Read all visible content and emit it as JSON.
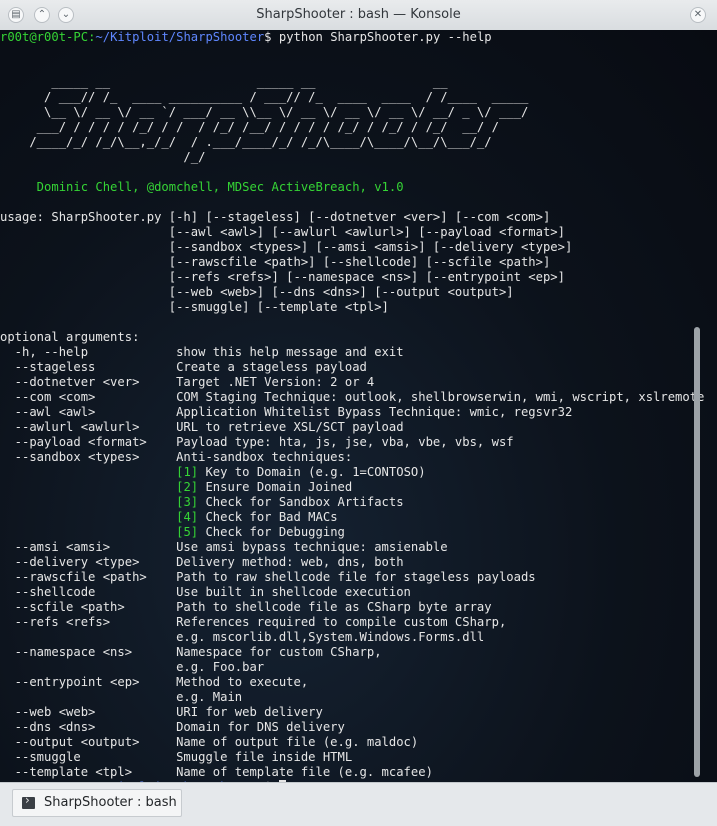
{
  "window": {
    "title": "SharpShooter : bash — Konsole"
  },
  "titlebar": {
    "menu_icon": "konsole-menu-icon",
    "keep_above_icon": "chevron-up-icon",
    "minimize_icon": "chevron-down-icon",
    "close_icon": "close-icon"
  },
  "prompt": {
    "user": "r00t@r00t-PC",
    "path": "~/Kitploit/SharpShooter"
  },
  "command": "python SharpShooter.py --help",
  "banner": [
    "       _____ __                    _____ __                __",
    "      / ___// /_  ____ __________ / ___// /_  ____  ____  / /____  _____",
    "      \\__ \\/ __ \\/ __ `/ ___/ __ \\\\__ \\/ __ \\/ __ \\/ __ \\/ __/ _ \\/ ___/",
    "     ___/ / / / / /_/ / /  / /_/ /__/ / / / / /_/ / /_/ / /_/  __/ /",
    "    /____/_/ /_/\\__,_/_/  / .___/____/_/ /_/\\____/\\____/\\__/\\___/_/",
    "                         /_/"
  ],
  "byline": "     Dominic Chell, @domchell, MDSec ActiveBreach, v1.0",
  "usage": [
    "usage: SharpShooter.py [-h] [--stageless] [--dotnetver <ver>] [--com <com>]",
    "                       [--awl <awl>] [--awlurl <awlurl>] [--payload <format>]",
    "                       [--sandbox <types>] [--amsi <amsi>] [--delivery <type>]",
    "                       [--rawscfile <path>] [--shellcode] [--scfile <path>]",
    "                       [--refs <refs>] [--namespace <ns>] [--entrypoint <ep>]",
    "                       [--web <web>] [--dns <dns>] [--output <output>]",
    "                       [--smuggle] [--template <tpl>]"
  ],
  "optional_header": "optional arguments:",
  "args_a": [
    "  -h, --help            show this help message and exit",
    "  --stageless           Create a stageless payload",
    "  --dotnetver <ver>     Target .NET Version: 2 or 4",
    "  --com <com>           COM Staging Technique: outlook, shellbrowserwin, wmi, wscript, xslremote",
    "  --awl <awl>           Application Whitelist Bypass Technique: wmic, regsvr32",
    "  --awlurl <awlurl>     URL to retrieve XSL/SCT payload",
    "  --payload <format>    Payload type: hta, js, jse, vba, vbe, vbs, wsf",
    "  --sandbox <types>     Anti-sandbox techniques:"
  ],
  "sandbox_indent": "                        ",
  "sandbox_items": [
    {
      "num": "[1]",
      "text": " Key to Domain (e.g. 1=CONTOSO)"
    },
    {
      "num": "[2]",
      "text": " Ensure Domain Joined"
    },
    {
      "num": "[3]",
      "text": " Check for Sandbox Artifacts"
    },
    {
      "num": "[4]",
      "text": " Check for Bad MACs"
    },
    {
      "num": "[5]",
      "text": " Check for Debugging"
    }
  ],
  "args_b": [
    "  --amsi <amsi>         Use amsi bypass technique: amsienable",
    "  --delivery <type>     Delivery method: web, dns, both",
    "  --rawscfile <path>    Path to raw shellcode file for stageless payloads",
    "  --shellcode           Use built in shellcode execution",
    "  --scfile <path>       Path to shellcode file as CSharp byte array",
    "  --refs <refs>         References required to compile custom CSharp,",
    "                        e.g. mscorlib.dll,System.Windows.Forms.dll",
    "  --namespace <ns>      Namespace for custom CSharp,",
    "                        e.g. Foo.bar",
    "  --entrypoint <ep>     Method to execute,",
    "                        e.g. Main",
    "  --web <web>           URI for web delivery",
    "  --dns <dns>           Domain for DNS delivery",
    "  --output <output>     Name of output file (e.g. maldoc)",
    "  --smuggle             Smuggle file inside HTML",
    "  --template <tpl>      Name of template file (e.g. mcafee)"
  ],
  "tab": {
    "label": "SharpShooter : bash",
    "icon": "terminal-icon"
  }
}
